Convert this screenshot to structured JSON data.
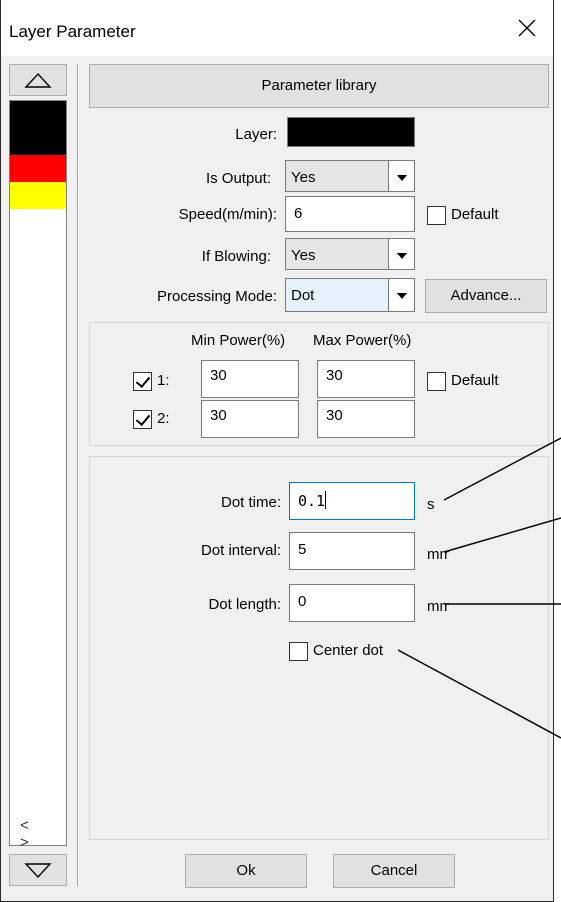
{
  "window": {
    "title": "Layer Parameter"
  },
  "left_panel": {
    "swatches": [
      "#000000",
      "#000000",
      "#ff0000",
      "#ffff00"
    ],
    "scroll_arrows": "< >"
  },
  "params": {
    "library_button": "Parameter library",
    "layer_label": "Layer:",
    "layer_color": "#000000",
    "is_output_label": "Is Output:",
    "is_output_value": "Yes",
    "speed_label": "Speed(m/min):",
    "speed_value": "6",
    "speed_default_label": "Default",
    "if_blowing_label": "If Blowing:",
    "if_blowing_value": "Yes",
    "processing_mode_label": "Processing Mode:",
    "processing_mode_value": "Dot",
    "advance_button": "Advance..."
  },
  "power": {
    "min_header": "Min Power(%)",
    "max_header": "Max Power(%)",
    "default_label": "Default",
    "rows": [
      {
        "label": "1:",
        "checked": true,
        "min": "30",
        "max": "30"
      },
      {
        "label": "2:",
        "checked": true,
        "min": "30",
        "max": "30"
      }
    ]
  },
  "dot": {
    "time_label": "Dot time:",
    "time_value": "0.1",
    "time_unit": "s",
    "interval_label": "Dot interval:",
    "interval_value": "5",
    "interval_unit": "mm",
    "length_label": "Dot length:",
    "length_value": "0",
    "length_unit": "mm",
    "center_label": "Center dot"
  },
  "footer": {
    "ok": "Ok",
    "cancel": "Cancel"
  }
}
